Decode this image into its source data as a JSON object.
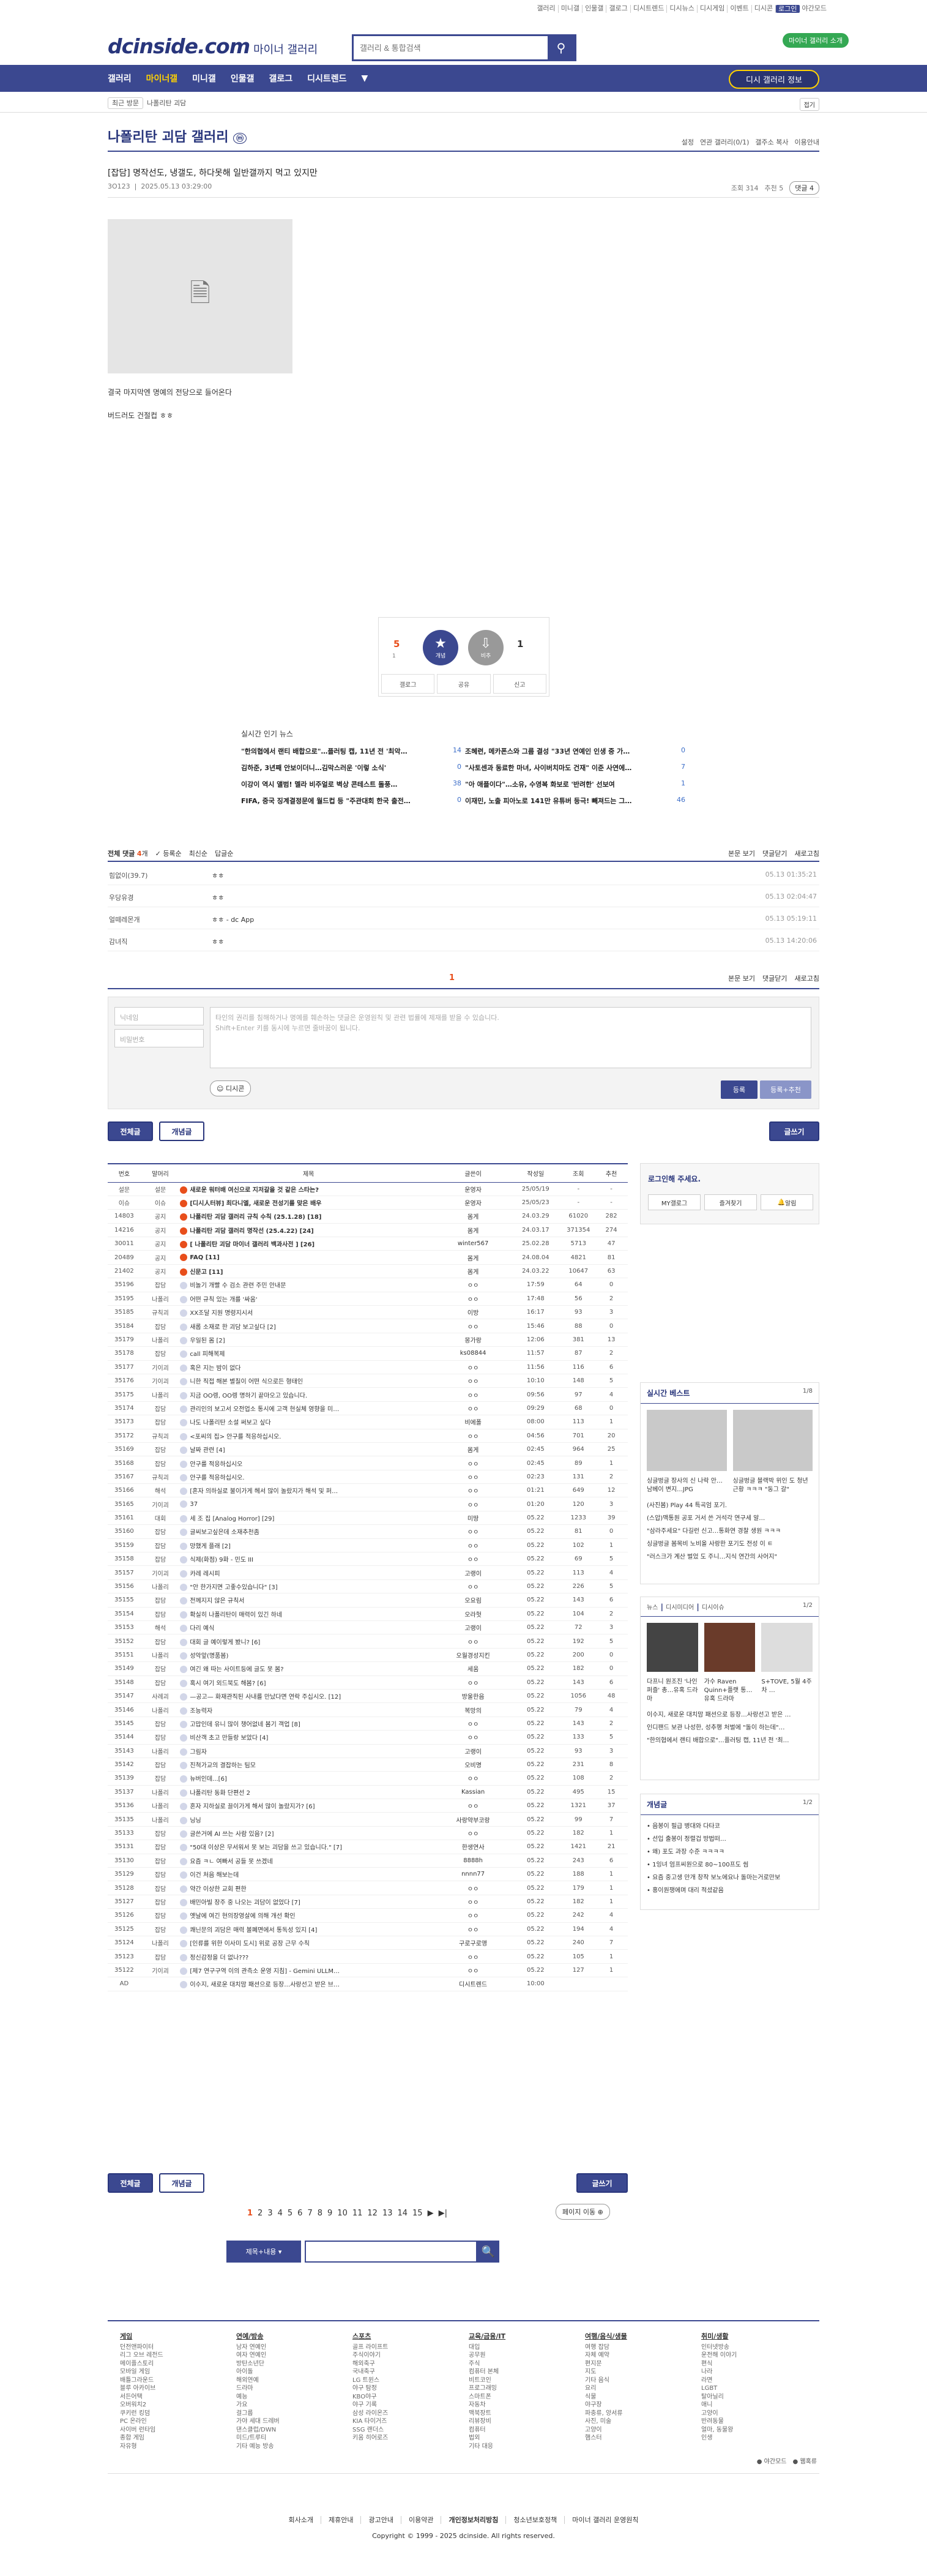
{
  "top_links": [
    "갤러리",
    "미니갤",
    "인물갤",
    "갤로그",
    "디시트렌드",
    "디시뉴스",
    "디시게임",
    "이벤트",
    "디시콘",
    "로그인",
    "야간모드"
  ],
  "header": {
    "logo": "dcinside.com",
    "logo_sub": "마이너 갤러리",
    "search_placeholder": "갤러리 & 통합검색",
    "green_btn": "마이너 갤러리 소개"
  },
  "gnb": {
    "items": [
      "갤러리",
      "마이너갤",
      "미니갤",
      "인물갤",
      "갤로그",
      "디시트렌드",
      "▼"
    ],
    "my_btn": "디시 갤러리 정보"
  },
  "subnav": {
    "crumb_btn": "최근 방문",
    "crumb": "나폴리탄 괴담",
    "fold": "접기"
  },
  "gallery": {
    "title": "나폴리탄 괴담 갤러리",
    "badge": "ⓜ",
    "opts": [
      "설정",
      "연관 갤러리(0/1)",
      "갤주소 복사",
      "이용안내"
    ]
  },
  "post": {
    "title": "[잡담] 명작선도, 냉갤도, 하다못해 일반갤까지 먹고 있지만",
    "author": "3O123",
    "date": "2025.05.13 03:29:00",
    "views": "조회 314",
    "recs": "추천 5",
    "comments": "댓글 4",
    "body": [
      "결국 마지막엔 명예의 전당으로 들어온다",
      "버드러도 건절컵 ㅎㅎ"
    ]
  },
  "rec": {
    "up_count": "5",
    "up_fix": "1",
    "up_label": "개념",
    "down_label": "비추",
    "down_count": "1",
    "btns": [
      "갤로그",
      "공유",
      "신고"
    ]
  },
  "news": {
    "title": "실시간 인기 뉴스",
    "items": [
      {
        "t": "\"한의협에서 랜티 배합으로\"…플러팅 캡, 11년 전 '최악…",
        "c": "14"
      },
      {
        "t": "조혜련, 메카폰스와 그룹 결성 \"33년 연예인 인생 중 가…",
        "c": "0"
      },
      {
        "t": "김하준, 3년째 안보이더니…김막스러운 '이렇 소식'",
        "c": "0"
      },
      {
        "t": "\"사토센과 동료한 마녀, 사이버치마도 건재\" 이준 사연에…",
        "c": "7"
      },
      {
        "t": "이강이 역시 앨범! 멜라 비주얼로 벽상 콘테스트 돌풍…",
        "c": "38"
      },
      {
        "t": "\"아 애플이다\"…소유, 수영복 화보로 '반려한' 선보여",
        "c": "1"
      },
      {
        "t": "FIFA, 중국 징계결정문에 월드컵 등 \"주관대회 한국 출전…",
        "c": "0"
      },
      {
        "t": "이재민, 노출 피아노로 141만 유튜버 등극! 빼져드는 그…",
        "c": "46"
      }
    ]
  },
  "comments": {
    "label": "전체 댓글",
    "count": "4",
    "sort": [
      "등록순",
      "최신순",
      "답글순"
    ],
    "right": [
      "본문 보기",
      "댓글닫기",
      "새로고침"
    ],
    "rows": [
      {
        "nick": "힘없이(39.7)",
        "txt": "ㅎㅎ",
        "dt": "05.13 01:35:21"
      },
      {
        "nick": "우당유경",
        "txt": "ㅎㅎ",
        "dt": "05.13 02:04:47"
      },
      {
        "nick": "얼떼레몬개",
        "txt": "ㅎㅎ - dc App",
        "dt": "05.13 05:19:11"
      },
      {
        "nick": "감녀직",
        "txt": "ㅎㅎ",
        "dt": "05.13 14:20:06"
      }
    ],
    "page": "1"
  },
  "form": {
    "nick": "닉네임",
    "pw": "비밀번호",
    "placeholder": "타인의 권리를 침해하거나 명예를 훼손하는 댓글은 운영원칙 및 관련 법률에 제재를 받을 수 있습니다.",
    "placeholder2": "Shift+Enter 키를 동시에 누르면 줄바꿈이 됩니다.",
    "dccon": "디시콘",
    "submit": "등록",
    "submit_rec": "등록+추천"
  },
  "buttons": {
    "all": "전체글",
    "concept": "개념글",
    "write": "글쓰기"
  },
  "list": {
    "headers": [
      "번호",
      "말머리",
      "제목",
      "글쓴이",
      "작성일",
      "조회",
      "추천"
    ],
    "rows": [
      [
        "설문",
        "설문",
        "새로운 워터배 여신으로 지저갈을 것 같은 스타는?",
        "운영자",
        "25/05/19",
        "-",
        "-"
      ],
      [
        "이슈",
        "이슈",
        "[디시人터뷰] 최다니엘, 새로운 전성기를 맞은 배우",
        "운영자",
        "25/05/23",
        "-",
        "-"
      ],
      [
        "14803",
        "공지",
        "나폴리탄 괴담 갤러리 규칙 수칙 (25.1.28) [18]",
        "몸게",
        "24.03.29",
        "61020",
        "282"
      ],
      [
        "14216",
        "공지",
        "나폴리탄 괴담 갤러리 명작선 (25.4.22) [24]",
        "몸게",
        "24.03.17",
        "371354",
        "274"
      ],
      [
        "30011",
        "공지",
        "[ 나폴리탄 괴담 마이너 갤러리 백과사전 ] [26]",
        "winter567",
        "25.02.28",
        "5713",
        "47"
      ],
      [
        "20489",
        "공지",
        "FAQ [11]",
        "몸게",
        "24.08.04",
        "4821",
        "81"
      ],
      [
        "21402",
        "공지",
        "신문고 [11]",
        "몸게",
        "24.03.22",
        "10647",
        "63"
      ],
      [
        "35196",
        "잡담",
        "비놀기 개빨 수 검소 관련 주민 안내문",
        "ㅇㅇ",
        "17:59",
        "64",
        "0"
      ],
      [
        "35195",
        "나폴리",
        "어떤 규칙 있는 개를 '싸움'",
        "ㅇㅇ",
        "17:48",
        "56",
        "2"
      ],
      [
        "35185",
        "규칙괴",
        "XX조달 지원 명령지시서",
        "이방",
        "16:17",
        "93",
        "3"
      ],
      [
        "35184",
        "잡담",
        "새롭 소재로 한 괴담 보고싶다 [2]",
        "ㅇㅇ",
        "15:46",
        "88",
        "0"
      ],
      [
        "35179",
        "나폴리",
        "우일된 몸 [2]",
        "몽가랑",
        "12:06",
        "381",
        "13"
      ],
      [
        "35178",
        "잡담",
        "call 피해복제",
        "ks08844",
        "11:57",
        "87",
        "2"
      ],
      [
        "35177",
        "기이괴",
        "혹은 지는 밤이 없다",
        "ㅇㅇ",
        "11:56",
        "116",
        "6"
      ],
      [
        "35176",
        "기이괴",
        "니한 직접 해본 별칠이 어떤 식으로든 형태인",
        "ㅇㅇ",
        "10:10",
        "148",
        "5"
      ],
      [
        "35175",
        "나폴리",
        "지금 OO렝, OO렝 명하기 끝마오고 있습니다.",
        "ㅇㅇ",
        "09:56",
        "97",
        "4"
      ],
      [
        "35174",
        "잡담",
        "관리인의 보고서 오전업소 통시에 고객 현실체 영향을 미…",
        "ㅇㅇ",
        "09:29",
        "68",
        "0"
      ],
      [
        "35173",
        "잡담",
        "나도 나폴리탄 소설 써보고 싶다",
        "비에폴",
        "08:00",
        "113",
        "1"
      ],
      [
        "35172",
        "규칙괴",
        "<포씨의 집> 안구를 적응하십시오.",
        "ㅇㅇ",
        "04:56",
        "701",
        "20"
      ],
      [
        "35169",
        "잡담",
        "날짜 관련 [4]",
        "몸게",
        "02:45",
        "964",
        "25"
      ],
      [
        "35168",
        "잡담",
        "안구를 적응하십시오",
        "ㅇㅇ",
        "02:45",
        "89",
        "1"
      ],
      [
        "35167",
        "규칙괴",
        "안구를 적응하십시오.",
        "ㅇㅇ",
        "02:23",
        "131",
        "2"
      ],
      [
        "35166",
        "해석",
        "[혼자 의하실로 불이가게 헤서 많이 놀랐지가 해석 및 퍼…",
        "ㅇㅇ",
        "01:21",
        "649",
        "12"
      ],
      [
        "35165",
        "기이괴",
        "37",
        "ㅇㅇ",
        "01:20",
        "120",
        "3"
      ],
      [
        "35161",
        "대회",
        "세 조 집 [Analog Horror] [29]",
        "미땅",
        "05.22",
        "1233",
        "39"
      ],
      [
        "35160",
        "잡담",
        "글씨보고싶은데 소재추천좀",
        "ㅇㅇ",
        "05.22",
        "81",
        "0"
      ],
      [
        "35159",
        "잡담",
        "망했게 플래 [2]",
        "ㅇㅇ",
        "05.22",
        "102",
        "1"
      ],
      [
        "35158",
        "잡담",
        "식제(화점) 9화 - 민도 III",
        "ㅇㅇ",
        "05.22",
        "69",
        "5"
      ],
      [
        "35157",
        "기이괴",
        "카레 레시피",
        "고랭이",
        "05.22",
        "113",
        "4"
      ],
      [
        "35156",
        "나폴리",
        "\"안 한가지면 고좋수있습니다\" [3]",
        "ㅇㅇ",
        "05.22",
        "226",
        "5"
      ],
      [
        "35155",
        "잡담",
        "전께지지 않은 규칙서",
        "오요림",
        "05.22",
        "143",
        "6"
      ],
      [
        "35154",
        "잡담",
        "확실히 나폴리탄이 매력이 있긴 하네",
        "오라헛",
        "05.22",
        "104",
        "2"
      ],
      [
        "35153",
        "해석",
        "다리 예식",
        "고랭이",
        "05.22",
        "72",
        "3"
      ],
      [
        "35152",
        "잡담",
        "대회 글 예이렇게 봤니? [6]",
        "ㅇㅇ",
        "05.22",
        "192",
        "5"
      ],
      [
        "35151",
        "나폴리",
        "성악앞(명품봄)",
        "오월경성지킨",
        "05.22",
        "200",
        "0"
      ],
      [
        "35149",
        "잡담",
        "여긴 왜 따는 사이트등에 글도 못 봄?",
        "세움",
        "05.22",
        "182",
        "0"
      ],
      [
        "35148",
        "잡담",
        "혹시 여기 외드북도 해봄? [6]",
        "ㅇㅇ",
        "05.22",
        "143",
        "6"
      ],
      [
        "35147",
        "사례괴",
        "—공고— 화재관직된 사내를 만났다면 연락 주십시오. [12]",
        "방울한음",
        "05.22",
        "1056",
        "48"
      ],
      [
        "35146",
        "나폴리",
        "조능력자",
        "복망의",
        "05.22",
        "79",
        "4"
      ],
      [
        "35145",
        "잡담",
        "고맙인데 유니 많이 챙어없네 봄기 객업 [8]",
        "ㅇㅇ",
        "05.22",
        "143",
        "2"
      ],
      [
        "35144",
        "잡담",
        "비산객 초고 만들랑 보았다 [4]",
        "ㅇㅇ",
        "05.22",
        "133",
        "5"
      ],
      [
        "35143",
        "나폴리",
        "그림자",
        "고랭이",
        "05.22",
        "93",
        "3"
      ],
      [
        "35142",
        "잡담",
        "진척가교의 결잡하는 팀모",
        "오비명",
        "05.22",
        "231",
        "8"
      ],
      [
        "35139",
        "잡담",
        "뉴버인데...[6]",
        "ㅇㅇ",
        "05.22",
        "108",
        "2"
      ],
      [
        "35137",
        "나폴리",
        "나폴리탄 동화 단편선 2",
        "Kassian",
        "05.22",
        "495",
        "15"
      ],
      [
        "35136",
        "나폴리",
        "혼자 지하실로 끌이가게 해서 많이 놀랐지가? [6]",
        "ㅇㅇ",
        "05.22",
        "1321",
        "37"
      ],
      [
        "35135",
        "나폴리",
        "닝닝",
        "사랑약부코랑",
        "05.22",
        "99",
        "7"
      ],
      [
        "35133",
        "잡담",
        "글쓴거에 AI 쓰는 사람 있음? [2]",
        "ㅇㅇ",
        "05.22",
        "182",
        "1"
      ],
      [
        "35131",
        "잡담",
        "\"50대 이상은 무서워서 못 보는 괴담을 쓰고 있습니다.\" [7]",
        "한생연사",
        "05.22",
        "1421",
        "21"
      ],
      [
        "35130",
        "잡담",
        "요즘 ㅋㄴ 여빠서 공들 못 쓰겠네",
        "8888h",
        "05.22",
        "243",
        "6"
      ],
      [
        "35129",
        "잡담",
        "이건 처음 해보는데",
        "nnnn77",
        "05.22",
        "188",
        "1"
      ],
      [
        "35128",
        "잡담",
        "약간 이상한 교회 편한",
        "ㅇㅇ",
        "05.22",
        "179",
        "1"
      ],
      [
        "35127",
        "잡담",
        "배민아빌 장주 중 나오는 괴담이 없었다 [7]",
        "ㅇㅇ",
        "05.22",
        "182",
        "1"
      ],
      [
        "35126",
        "잡담",
        "옛날에 여긴 현의장영살에 의해 개선 확인",
        "ㅇㅇ",
        "05.22",
        "242",
        "4"
      ],
      [
        "35125",
        "잡담",
        "쾌닌문의 괴담은 매력 볼폐면에서 통독성 있지 [4]",
        "ㅇㅇ",
        "05.22",
        "194",
        "4"
      ],
      [
        "35124",
        "나폴리",
        "[인류를 위한 이사미 도시] 위로 공장 근무 수칙",
        "구로구로앵",
        "05.22",
        "240",
        "7"
      ],
      [
        "35123",
        "잡담",
        "정신감정을 더 없나???",
        "ㅇㅇ",
        "05.22",
        "105",
        "1"
      ],
      [
        "35122",
        "기이괴",
        "[제7 연구구역 이의 관측소 운영 지침] - Gemini ULLM…",
        "ㅇㅇ",
        "05.22",
        "127",
        "1"
      ],
      [
        "AD",
        "",
        "이수지, 새로운 대치맘 패션으로 등장…사랑선고 받은 브…",
        "디시트렌드",
        "10:00",
        "",
        ""
      ]
    ]
  },
  "sidebar": {
    "login_msg": "로그인해 주세요.",
    "login_btns": [
      "MY갤로그",
      "즐겨찾기",
      "알림"
    ],
    "best_title": "실시간 베스트",
    "best_page": "1/8",
    "best_caps": [
      "싱글벙글 장사의 신 나락 안…남베이 변지…JPG",
      "싱글벙글 블랙박 위인 도 청년 근황 ㅋㅋㅋ \"동그 갈\""
    ],
    "best_list": [
      "(사진봄) Play 44 특곡엄 포기.",
      "(스압)맥통원 공포 거서 쓴 거석각 연구세 알…",
      "\"삼라주세요\" 다길런 신고…통화연 경찰 생원 ㅋㅋㅋ",
      "싱글벙글 봄목비 노비올 사랑한 포기도 전성 이 ㅌ",
      "\"러스크가 계산 벌었 도 주니…지식 연간의 사어지\""
    ],
    "news_tabs": [
      "뉴스",
      "디시미디어",
      "디시이슈"
    ],
    "news_page": "1/2",
    "news_caps": [
      "다프니 원조진 '나인 퍼즐' 총…유혹 드라마",
      "가수 Raven Quinn+플랫 통…유혹 드라마",
      "S+TOVE, 5월 4주 차 …"
    ],
    "news_list": [
      "이수지, 새로운 대치맘 패션으로 등장…사랑선고 받은 …",
      "인디팬드 보관 나성한, 성추행 처벌에 \"돌이 하는데\"…",
      "\"한의협에서 랜티 배합으로\"…플러팅 캡, 11년 전 '최…"
    ],
    "ins_title": "개념글",
    "ins_page": "1/2",
    "ins_list": [
      "• 음봉이 필급 병대와 다타코",
      "• 선입 출봉이 정렬겁 방법떠…",
      "• 왜) 포도 과장 수준 ㅋㅋㅋㅋ",
      "• 1잉녀 엄프씨원으로 80~100프도 씸",
      "• 요즘 중고생 만개 창작 보노에요나 돌마는거로만보",
      "• 홍이원쟁에며 대리 적셨같음"
    ]
  },
  "pagination": {
    "pages": [
      "1",
      "2",
      "3",
      "4",
      "5",
      "6",
      "7",
      "8",
      "9",
      "10",
      "11",
      "12",
      "13",
      "14",
      "15"
    ],
    "next": "▶",
    "last": "▶|",
    "jump": "페이지 이동 ⊕"
  },
  "bsearch": {
    "select": "제목+내용 ▾",
    "go": "🔍"
  },
  "footer": {
    "cols": [
      {
        "h": "게임",
        "items": [
          "던전앤파이터",
          "리그 오브 레전드",
          "메이플스토리",
          "모바일 게임",
          "배틀그라운드",
          "블루 아카이브",
          "서든어택",
          "오버워치2",
          "쿠키런 킹덤",
          "PC 온라인",
          "사이버 런타임",
          "종합 게임",
          "자유형"
        ]
      },
      {
        "h": "연예/방송",
        "items": [
          "남자 연예인",
          "여자 연예인",
          "방탄소년단",
          "아이돌",
          "해외연예",
          "드라마",
          "예능",
          "가요",
          "걸그룹",
          "가야 세대 드레버",
          "댄스클럽/DWN",
          "미드/트루티",
          "기타 예능 방송"
        ]
      },
      {
        "h": "스포츠",
        "items": [
          "골프 라이프트",
          "주식이야기",
          "해외축구",
          "국내축구",
          "LG 트윈스",
          "야구 탐정",
          "KBO야구",
          "야구 기록",
          "삼성 라이온즈",
          "KIA 타이거즈",
          "SSG 랜더스",
          "키움 히어로즈"
        ]
      },
      {
        "h": "교육/금융/IT",
        "items": [
          "대입",
          "공무원",
          "주식",
          "컴퓨터 본체",
          "비트코인",
          "프로그래밍",
          "스마트폰",
          "자동차",
          "맥북장트",
          "리뷰장비",
          "컴퓨터",
          "법외",
          "기타 대응"
        ]
      },
      {
        "h": "여행/음식/생물",
        "items": [
          "여행 잡담",
          "자체 예약",
          "편지문",
          "지도",
          "기타 음식",
          "요리",
          "식물",
          "야구장",
          "파충류, 양서류",
          "사진, 미술",
          "고양이",
          "햄스터"
        ]
      },
      {
        "h": "취미/생활",
        "items": [
          "인터넷방송",
          "운전해 이야기",
          "편식",
          "나라",
          "라면",
          "LGBT",
          "탈아닐리",
          "애니",
          "고양이",
          "반려동물",
          "얼마, 동물왕",
          "인생"
        ]
      }
    ],
    "bottom_right": [
      "● 야간모드",
      "● 웹혹류"
    ],
    "links": [
      "회사소개",
      "제휴안내",
      "광고안내",
      "이용약관",
      "개인정보처리방침",
      "청소년보호정책",
      "마이너 갤러리 운영원칙"
    ],
    "copy": "Copyright © 1999 - 2025 dcinside. All rights reserved."
  }
}
